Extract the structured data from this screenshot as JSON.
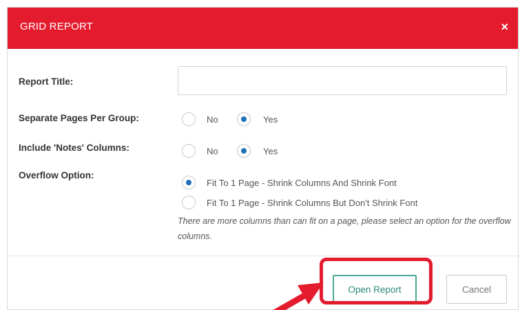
{
  "dialog": {
    "title": "GRID REPORT",
    "close_glyph": "×",
    "header_color": "#e31b2d"
  },
  "form": {
    "report_title": {
      "label": "Report Title:",
      "value": ""
    },
    "separate_pages": {
      "label": "Separate Pages Per Group:",
      "options": [
        "No",
        "Yes"
      ],
      "selected": "Yes"
    },
    "include_notes": {
      "label": "Include 'Notes' Columns:",
      "options": [
        "No",
        "Yes"
      ],
      "selected": "Yes"
    },
    "overflow": {
      "label": "Overflow Option:",
      "options": [
        "Fit To 1 Page - Shrink Columns And Shrink Font",
        "Fit To 1 Page - Shrink Columns But Don't Shrink Font"
      ],
      "selected_index": 0,
      "note": "There are more columns than can fit on a page, please select an option for the overflow columns."
    }
  },
  "footer": {
    "open_label": "Open Report",
    "cancel_label": "Cancel"
  },
  "annotation": {
    "highlight_color": "#e31b2d",
    "arrow": "red-arrow-pointing-to-open-report"
  }
}
